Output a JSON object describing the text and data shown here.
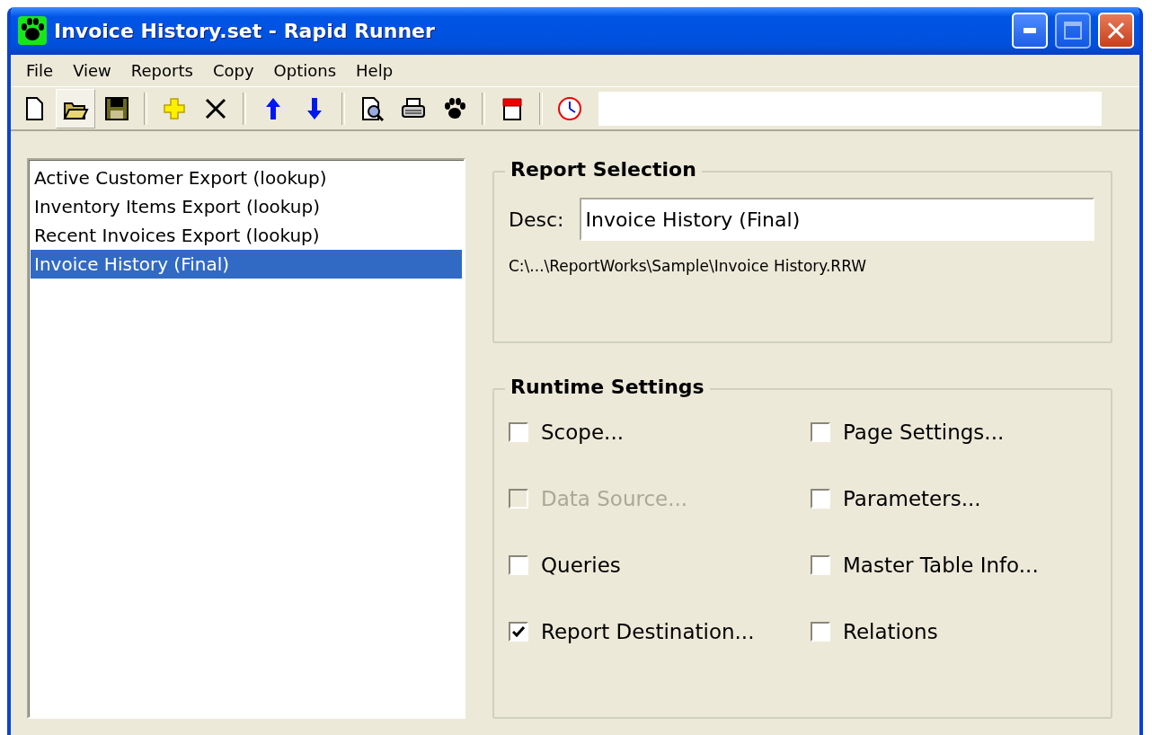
{
  "window": {
    "title": "Invoice History.set - Rapid Runner"
  },
  "menu": [
    "File",
    "View",
    "Reports",
    "Copy",
    "Options",
    "Help"
  ],
  "toolbar": {
    "buttons": [
      {
        "kind": "new",
        "pressed": false
      },
      {
        "kind": "open",
        "pressed": true
      },
      {
        "kind": "save",
        "pressed": false
      },
      {
        "kind": "sep"
      },
      {
        "kind": "add",
        "pressed": false
      },
      {
        "kind": "delete",
        "pressed": false
      },
      {
        "kind": "sep"
      },
      {
        "kind": "up",
        "pressed": false
      },
      {
        "kind": "down",
        "pressed": false
      },
      {
        "kind": "sep"
      },
      {
        "kind": "preview",
        "pressed": false
      },
      {
        "kind": "print",
        "pressed": false
      },
      {
        "kind": "paw",
        "pressed": false
      },
      {
        "kind": "sep"
      },
      {
        "kind": "notepad",
        "pressed": false
      },
      {
        "kind": "sep"
      },
      {
        "kind": "clock",
        "pressed": false
      }
    ]
  },
  "reports": [
    {
      "label": "Active Customer Export (lookup)",
      "selected": false
    },
    {
      "label": "Inventory Items Export (lookup)",
      "selected": false
    },
    {
      "label": "Recent Invoices Export (lookup)",
      "selected": false
    },
    {
      "label": "Invoice History (Final)",
      "selected": true
    }
  ],
  "report_selection": {
    "title": "Report Selection",
    "desc_label": "Desc:",
    "desc_value": "Invoice History (Final)",
    "path": "C:\\...\\ReportWorks\\Sample\\Invoice History.RRW"
  },
  "runtime_settings": {
    "title": "Runtime Settings",
    "options": [
      {
        "label": "Scope...",
        "checked": false,
        "disabled": false
      },
      {
        "label": "Page Settings...",
        "checked": false,
        "disabled": false
      },
      {
        "label": "Data Source...",
        "checked": false,
        "disabled": true
      },
      {
        "label": "Parameters...",
        "checked": false,
        "disabled": false
      },
      {
        "label": "Queries",
        "checked": false,
        "disabled": false
      },
      {
        "label": "Master Table Info...",
        "checked": false,
        "disabled": false
      },
      {
        "label": "Report Destination...",
        "checked": true,
        "disabled": false
      },
      {
        "label": "Relations",
        "checked": false,
        "disabled": false
      }
    ]
  }
}
